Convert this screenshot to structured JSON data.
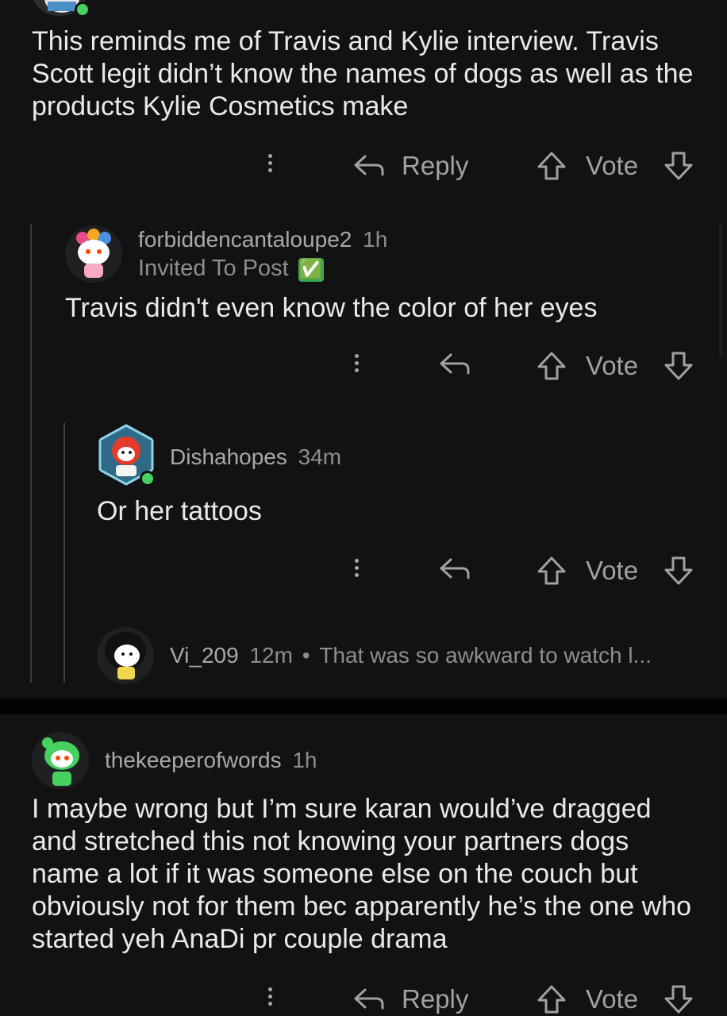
{
  "comment1": {
    "body": "This reminds me of Travis and Kylie interview. Travis Scott legit didn’t know the names of dogs as well as the products Kylie Cosmetics make",
    "reply_label": "Reply",
    "vote_label": "Vote"
  },
  "comment2": {
    "username": "forbiddencantaloupe2",
    "time": "1h",
    "flair": "Invited To Post",
    "flair_emoji": "✅",
    "body": "Travis didn't even know the color of her eyes",
    "vote_label": "Vote"
  },
  "comment3": {
    "username": "Dishahopes",
    "time": "34m",
    "body": "Or her tattoos",
    "vote_label": "Vote"
  },
  "comment4": {
    "username": "Vi_209",
    "time": "12m",
    "separator": "•",
    "preview": "That was so awkward to watch l..."
  },
  "comment5": {
    "username": "thekeeperofwords",
    "time": "1h",
    "body": "I maybe wrong but I’m sure karan would’ve dragged and stretched this not knowing your partners dogs name a lot if it was someone else on the couch but obviously not for them bec apparently he’s the one who started yeh AnaDi  pr couple drama",
    "reply_label": "Reply",
    "vote_label": "Vote"
  },
  "colors": {
    "background": "#121213",
    "text": "#e8eaec",
    "muted": "#8b8f94",
    "online": "#46d160"
  }
}
